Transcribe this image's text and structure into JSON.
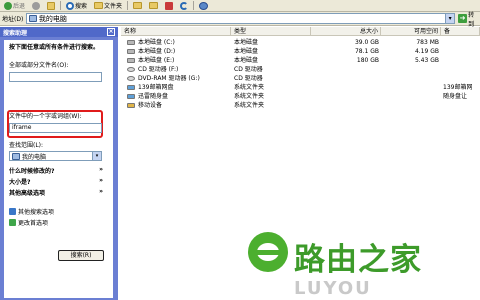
{
  "toolbar": {
    "back_label": "后退",
    "search_label": "搜索",
    "folders_label": "文件夹"
  },
  "address": {
    "label": "地址(D)",
    "value": "我的电脑",
    "go_label": "转到"
  },
  "panel": {
    "title": "搜索助理",
    "heading": "按下面任意或所有条件进行搜索。",
    "name_label": "全部或部分文件名(O):",
    "name_value": "",
    "word_label": "文件中的一个字或词组(W):",
    "word_value": "iframe",
    "scope_label": "查找范围(L):",
    "scope_value": "我的电脑",
    "options": [
      {
        "label": "什么时候修改的?",
        "arrow": "»"
      },
      {
        "label": "大小是?",
        "arrow": "»"
      },
      {
        "label": "其他高级选项",
        "arrow": "»"
      }
    ],
    "links": [
      "其他搜索选项",
      "更改首选项"
    ],
    "search_button": "搜索(R)"
  },
  "list": {
    "columns": [
      "名称",
      "类型",
      "总大小",
      "可用空间",
      "备"
    ],
    "rows": [
      {
        "name": "本地磁盘 (C:)",
        "type": "本地磁盘",
        "total": "39.0 GB",
        "free": "783 MB",
        "note": "",
        "icon": "drive-icon"
      },
      {
        "name": "本地磁盘 (D:)",
        "type": "本地磁盘",
        "total": "78.1 GB",
        "free": "4.19 GB",
        "note": "",
        "icon": "drive-icon"
      },
      {
        "name": "本地磁盘 (E:)",
        "type": "本地磁盘",
        "total": "180 GB",
        "free": "5.43 GB",
        "note": "",
        "icon": "drive-icon"
      },
      {
        "name": "CD 驱动器 (F:)",
        "type": "CD 驱动器",
        "total": "",
        "free": "",
        "note": "",
        "icon": "cd-icon"
      },
      {
        "name": "DVD-RAM 驱动器 (G:)",
        "type": "CD 驱动器",
        "total": "",
        "free": "",
        "note": "",
        "icon": "cd-icon"
      },
      {
        "name": "139邮箱网盘",
        "type": "系统文件夹",
        "total": "",
        "free": "",
        "note": "139邮箱网",
        "icon": "network-folder-icon"
      },
      {
        "name": "迅雷随身盘",
        "type": "系统文件夹",
        "total": "",
        "free": "",
        "note": "随身盘让",
        "icon": "network-folder-icon"
      },
      {
        "name": "移动设备",
        "type": "系统文件夹",
        "total": "",
        "free": "",
        "note": "",
        "icon": "usb-icon"
      }
    ]
  },
  "watermark": {
    "text": "路由之家",
    "sub": "LUYOU"
  },
  "colors": {
    "panel_bg": "#6b7fd3",
    "highlight_border": "#e01b1b",
    "watermark_green": "#3d9b2a"
  }
}
